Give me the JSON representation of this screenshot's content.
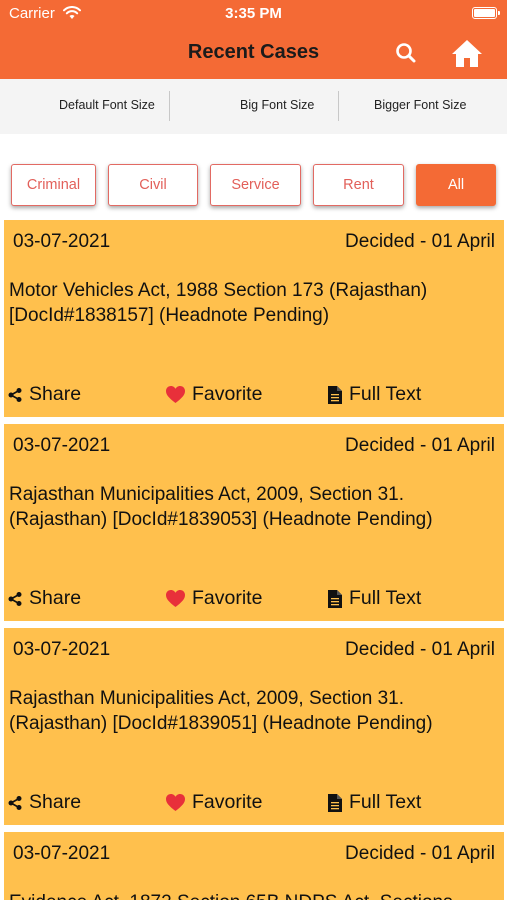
{
  "status_bar": {
    "carrier": "Carrier",
    "time": "3:35 PM"
  },
  "navbar": {
    "title": "Recent Cases"
  },
  "font_options": [
    "Default Font Size",
    "Big Font Size",
    "Bigger Font Size"
  ],
  "filters": [
    {
      "label": "Criminal",
      "active": false
    },
    {
      "label": "Civil",
      "active": false
    },
    {
      "label": "Service",
      "active": false
    },
    {
      "label": "Rent",
      "active": false
    },
    {
      "label": "All",
      "active": true
    }
  ],
  "actions": {
    "share": "Share",
    "favorite": "Favorite",
    "full_text": "Full Text"
  },
  "cases": [
    {
      "date": "03-07-2021",
      "status": "Decided - 01 April",
      "description": "Motor Vehicles Act, 1988 Section 173 (Rajasthan) [DocId#1838157] (Headnote Pending)"
    },
    {
      "date": "03-07-2021",
      "status": "Decided - 01 April",
      "description": "Rajasthan Municipalities Act, 2009, Section 31. (Rajasthan) [DocId#1839053] (Headnote Pending)"
    },
    {
      "date": "03-07-2021",
      "status": "Decided - 01 April",
      "description": "Rajasthan Municipalities Act, 2009, Section 31. (Rajasthan) [DocId#1839051] (Headnote Pending)"
    },
    {
      "date": "03-07-2021",
      "status": "Decided - 01 April",
      "description": "Evidence Act, 1872 Section 65B NDPS Act, Sections"
    }
  ],
  "colors": {
    "accent": "#f46a35",
    "card": "#ffc04d",
    "chip_border": "#e26a63",
    "heart": "#e8303a"
  }
}
